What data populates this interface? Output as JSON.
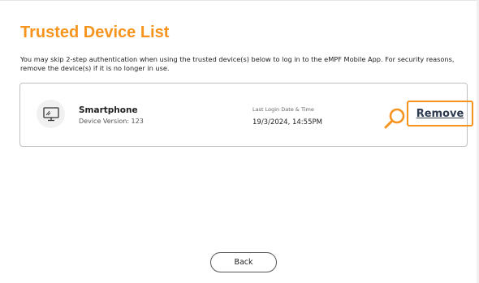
{
  "page": {
    "title": "Trusted Device List",
    "intro": "You may skip 2-step authentication when using the trusted device(s) below to log in to the eMPF Mobile App. For security reasons, remove the device(s) if it is no longer in use."
  },
  "device": {
    "icon": "computer-monitor-icon",
    "name": "Smartphone",
    "version": "Device Version: 123",
    "last_login_label": "Last Login Date & Time",
    "last_login_value": "19/3/2024, 14:55PM",
    "remove_label": "Remove"
  },
  "footer": {
    "back_label": "Back"
  },
  "colors": {
    "accent": "#f7941d",
    "link": "#2e3a4f",
    "card_border": "#bfbfbf"
  }
}
